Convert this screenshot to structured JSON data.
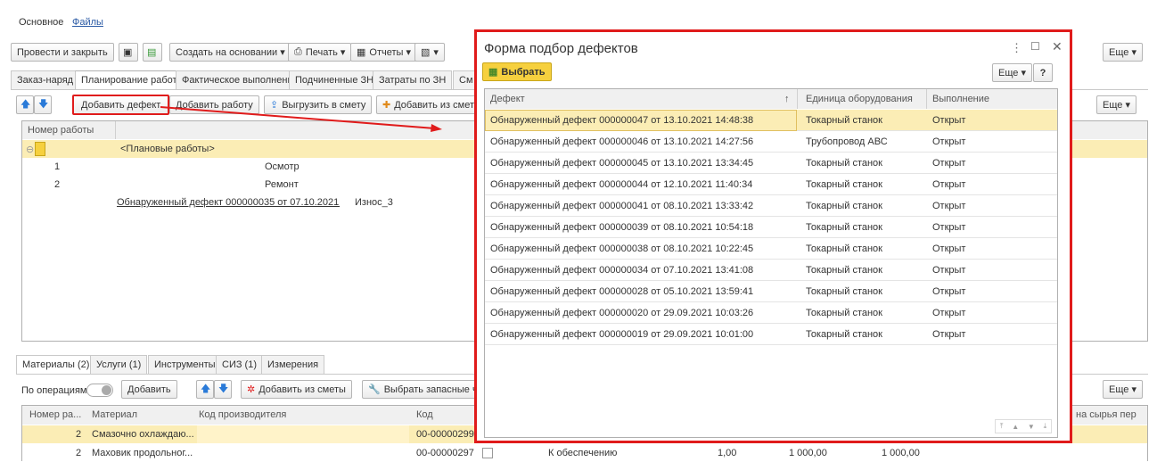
{
  "top_links": {
    "main": "Основное",
    "files": "Файлы"
  },
  "toolbar": {
    "post_close": "Провести и закрыть",
    "create_based": "Создать на основании",
    "print": "Печать",
    "reports": "Отчеты",
    "more": "Еще"
  },
  "tabs": [
    "Заказ-наряд",
    "Планирование работ",
    "Фактическое выполнение",
    "Подчиненные ЗН",
    "Затраты по ЗН",
    "См"
  ],
  "work_toolbar": {
    "add_defect": "Добавить дефект",
    "add_work": "Добавить работу",
    "export_estimate": "Выгрузить в смету",
    "add_from_estimate": "Добавить из сметы",
    "more": "Еще"
  },
  "work_table": {
    "col_number": "Номер работы",
    "rows": [
      {
        "num": "",
        "name": "<Плановые работы>"
      },
      {
        "num": "1",
        "name": "Осмотр"
      },
      {
        "num": "2",
        "name": "Ремонт"
      },
      {
        "num": "",
        "name": "Обнаруженный дефект 000000035 от 07.10.2021 1...",
        "extra": "Износ_3"
      }
    ]
  },
  "bottom_tabs": [
    "Материалы (2)",
    "Услуги (1)",
    "Инструменты",
    "СИЗ (1)",
    "Измерения"
  ],
  "bottom_toolbar": {
    "by_ops_label": "По операциям:",
    "add": "Добавить",
    "add_from_estimate": "Добавить из сметы",
    "select_parts": "Выбрать запасные час",
    "more": "Еще"
  },
  "materials_table": {
    "headers": [
      "Номер ра...",
      "Материал",
      "Код производителя",
      "Код"
    ],
    "right_header_fragment": "на сырья пер",
    "rows": [
      {
        "num": "2",
        "material": "Смазочно охлаждаю...",
        "code": "00-00000299"
      },
      {
        "num": "2",
        "material": "Маховик продольног...",
        "code": "00-00000297",
        "status": "К обеспечению",
        "qty": "1,00",
        "price": "1 000,00",
        "sum": "1 000,00"
      }
    ]
  },
  "dialog": {
    "title": "Форма подбор дефектов",
    "select_btn": "Выбрать",
    "more": "Еще",
    "help": "?",
    "headers": {
      "defect": "Дефект",
      "sort": "↑",
      "equipment": "Единица оборудования",
      "status": "Выполнение"
    },
    "rows": [
      {
        "defect": "Обнаруженный дефект 000000047 от 13.10.2021 14:48:38",
        "equipment": "Токарный станок",
        "status": "Открыт"
      },
      {
        "defect": "Обнаруженный дефект 000000046 от 13.10.2021 14:27:56",
        "equipment": "Трубопровод АВС",
        "status": "Открыт"
      },
      {
        "defect": "Обнаруженный дефект 000000045 от 13.10.2021 13:34:45",
        "equipment": "Токарный станок",
        "status": "Открыт"
      },
      {
        "defect": "Обнаруженный дефект 000000044 от 12.10.2021 11:40:34",
        "equipment": "Токарный станок",
        "status": "Открыт"
      },
      {
        "defect": "Обнаруженный дефект 000000041 от 08.10.2021 13:33:42",
        "equipment": "Токарный станок",
        "status": "Открыт"
      },
      {
        "defect": "Обнаруженный дефект 000000039 от 08.10.2021 10:54:18",
        "equipment": "Токарный станок",
        "status": "Открыт"
      },
      {
        "defect": "Обнаруженный дефект 000000038 от 08.10.2021 10:22:45",
        "equipment": "Токарный станок",
        "status": "Открыт"
      },
      {
        "defect": "Обнаруженный дефект 000000034 от 07.10.2021 13:41:08",
        "equipment": "Токарный станок",
        "status": "Открыт"
      },
      {
        "defect": "Обнаруженный дефект 000000028 от 05.10.2021 13:59:41",
        "equipment": "Токарный станок",
        "status": "Открыт"
      },
      {
        "defect": "Обнаруженный дефект 000000020 от 29.09.2021 10:03:26",
        "equipment": "Токарный станок",
        "status": "Открыт"
      },
      {
        "defect": "Обнаруженный дефект 000000019 от 29.09.2021 10:01:00",
        "equipment": "Токарный станок",
        "status": "Открыт"
      }
    ]
  },
  "colors": {
    "highlight": "#e01b1b",
    "selected_row": "#fbedb5",
    "accent_yellow": "#f6d03e"
  }
}
